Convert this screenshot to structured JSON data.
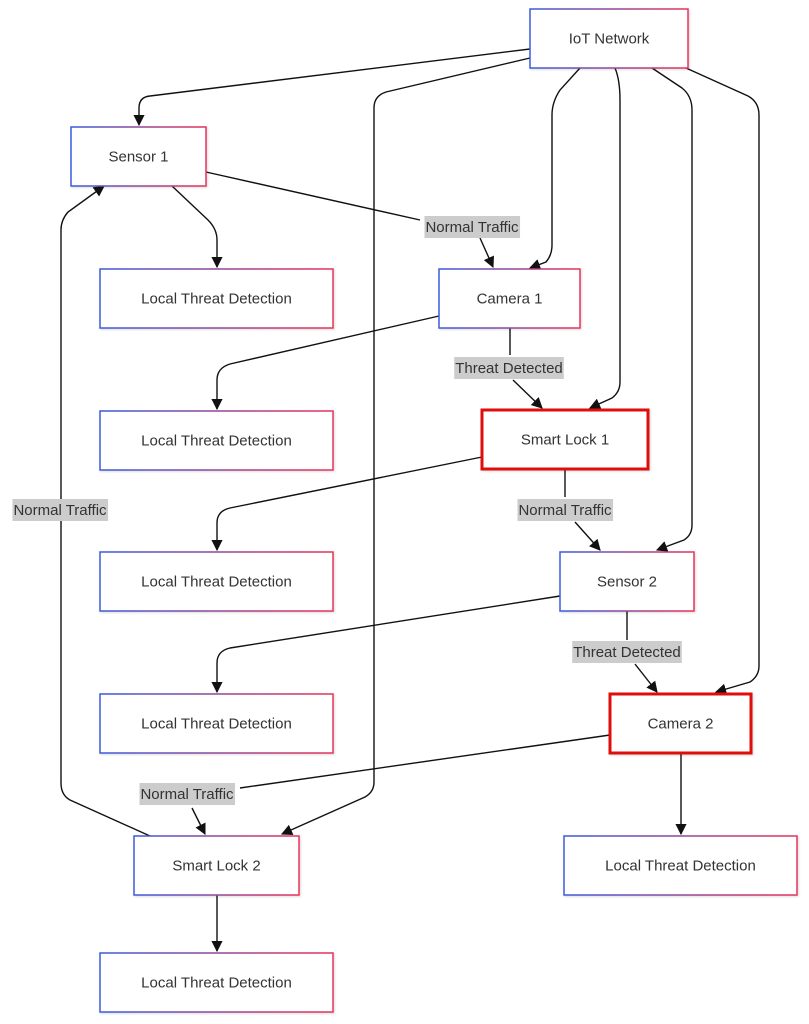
{
  "diagram": {
    "type": "flowchart",
    "direction": "top-down",
    "colors": {
      "node_border_gradient_start": "#3b5bdb",
      "node_border_gradient_end": "#e8335a",
      "highlight_border": "#e01010",
      "edge": "#111111",
      "edge_label_bg": "#cccccc",
      "text": "#333333"
    },
    "nodes": [
      {
        "id": "iot",
        "label": "IoT Network",
        "highlight": false
      },
      {
        "id": "s1",
        "label": "Sensor 1",
        "highlight": false
      },
      {
        "id": "ltd1",
        "label": "Local Threat Detection",
        "highlight": false
      },
      {
        "id": "c1",
        "label": "Camera 1",
        "highlight": false
      },
      {
        "id": "ltd2",
        "label": "Local Threat Detection",
        "highlight": false
      },
      {
        "id": "sl1",
        "label": "Smart Lock 1",
        "highlight": true
      },
      {
        "id": "ltd3",
        "label": "Local Threat Detection",
        "highlight": false
      },
      {
        "id": "s2",
        "label": "Sensor 2",
        "highlight": false
      },
      {
        "id": "ltd4",
        "label": "Local Threat Detection",
        "highlight": false
      },
      {
        "id": "c2",
        "label": "Camera 2",
        "highlight": true
      },
      {
        "id": "ltd5",
        "label": "Local Threat Detection",
        "highlight": false
      },
      {
        "id": "sl2",
        "label": "Smart Lock 2",
        "highlight": false
      },
      {
        "id": "ltd6",
        "label": "Local Threat Detection",
        "highlight": false
      }
    ],
    "edges": [
      {
        "from": "iot",
        "to": "s1",
        "label": ""
      },
      {
        "from": "iot",
        "to": "sl2",
        "label": ""
      },
      {
        "from": "iot",
        "to": "c1",
        "label": ""
      },
      {
        "from": "iot",
        "to": "sl1",
        "label": ""
      },
      {
        "from": "iot",
        "to": "s2",
        "label": ""
      },
      {
        "from": "iot",
        "to": "c2",
        "label": ""
      },
      {
        "from": "s1",
        "to": "ltd1",
        "label": ""
      },
      {
        "from": "s1",
        "to": "c1",
        "label": "Normal Traffic"
      },
      {
        "from": "c1",
        "to": "ltd2",
        "label": ""
      },
      {
        "from": "c1",
        "to": "sl1",
        "label": "Threat Detected"
      },
      {
        "from": "sl1",
        "to": "ltd3",
        "label": ""
      },
      {
        "from": "sl1",
        "to": "s2",
        "label": "Normal Traffic"
      },
      {
        "from": "s2",
        "to": "ltd4",
        "label": ""
      },
      {
        "from": "s2",
        "to": "c2",
        "label": "Threat Detected"
      },
      {
        "from": "c2",
        "to": "ltd5",
        "label": ""
      },
      {
        "from": "c2",
        "to": "sl2",
        "label": "Normal Traffic"
      },
      {
        "from": "sl2",
        "to": "ltd6",
        "label": ""
      },
      {
        "from": "sl2",
        "to": "s1",
        "label": "Normal Traffic"
      }
    ]
  }
}
